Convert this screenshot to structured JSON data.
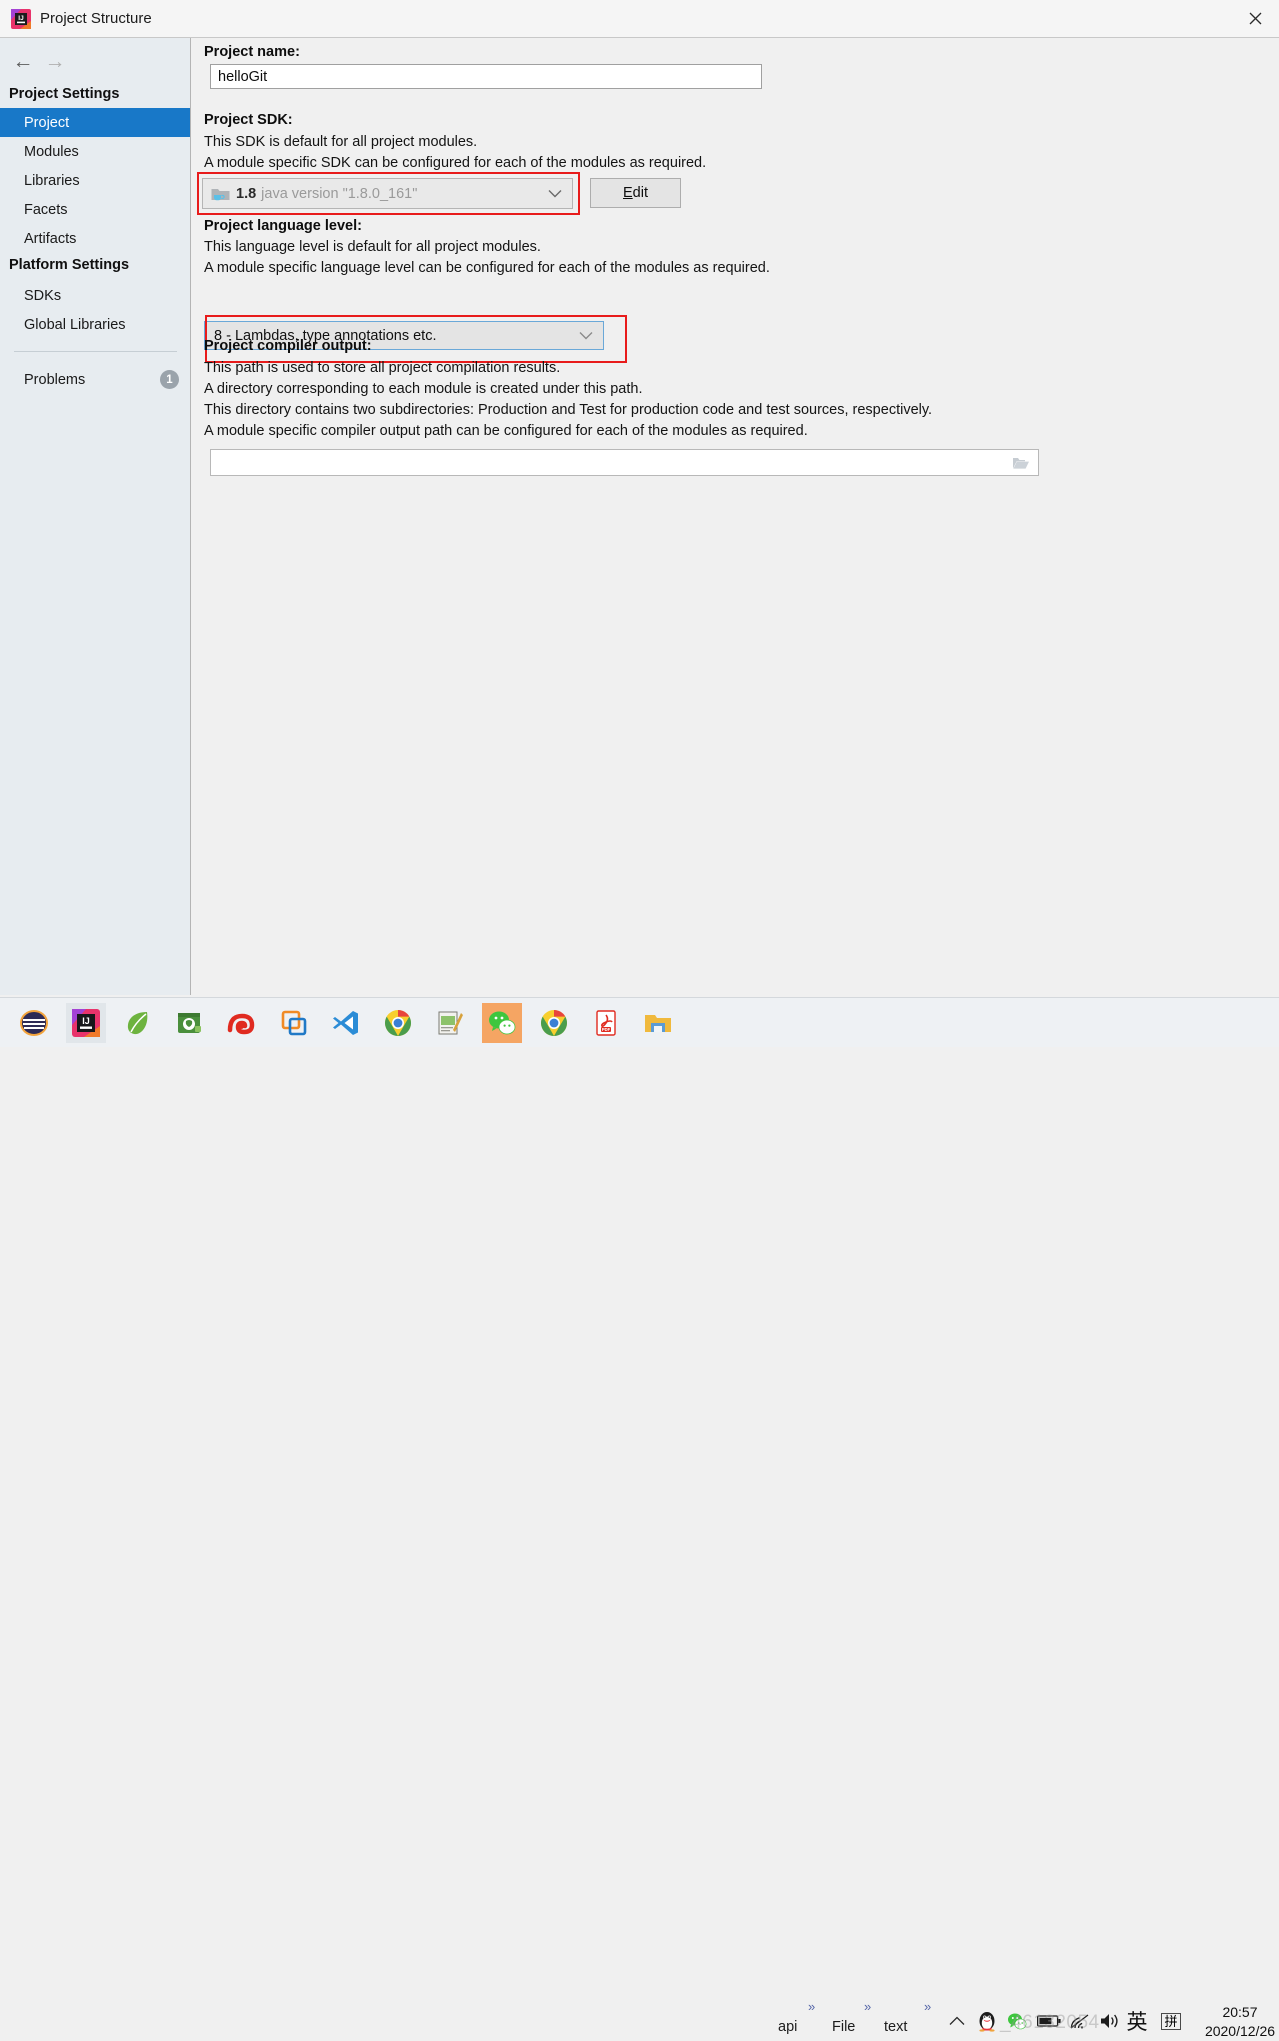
{
  "window": {
    "title": "Project Structure",
    "app_icon": "intellij-idea-icon",
    "close_icon": "close-icon"
  },
  "sidebar": {
    "nav": {
      "back_icon": "arrow-left-icon",
      "forward_icon": "arrow-right-icon"
    },
    "groups": [
      {
        "label": "Project Settings"
      },
      {
        "label": "Platform Settings"
      }
    ],
    "project_items": [
      {
        "label": "Project",
        "selected": true
      },
      {
        "label": "Modules",
        "selected": false
      },
      {
        "label": "Libraries",
        "selected": false
      },
      {
        "label": "Facets",
        "selected": false
      },
      {
        "label": "Artifacts",
        "selected": false
      }
    ],
    "platform_items": [
      {
        "label": "SDKs",
        "selected": false
      },
      {
        "label": "Global Libraries",
        "selected": false
      }
    ],
    "problems": {
      "label": "Problems",
      "count": "1"
    },
    "selected_color": "#1878c8",
    "background_color": "#e7ecf0"
  },
  "main": {
    "project_name": {
      "label": "Project name:",
      "value": "helloGit"
    },
    "project_sdk": {
      "label": "Project SDK:",
      "desc_line1": "This SDK is default for all project modules.",
      "desc_line2": "A module specific SDK can be configured for each of the modules as required.",
      "sdk_icon": "java-sdk-folder-icon",
      "version": "1.8",
      "version_desc": "java version \"1.8.0_161\"",
      "chevron": "⌄",
      "edit_button": "Edit",
      "edit_mnemonic": "E",
      "edit_rest": "dit"
    },
    "language_level": {
      "label": "Project language level:",
      "desc_line1": "This language level is default for all project modules.",
      "desc_line2": "A module specific language level can be configured for each of the modules as required.",
      "value": "8 - Lambdas, type annotations etc.",
      "chevron": "⌄"
    },
    "compiler_output": {
      "label": "Project compiler output:",
      "desc_line1": "This path is used to store all project compilation results.",
      "desc_line2": "A directory corresponding to each module is created under this path.",
      "desc_line3": "This directory contains two subdirectories: Production and Test for production code and test sources, respectively.",
      "desc_line4": "A module specific compiler output path can be configured for each of the modules as required.",
      "value": "",
      "placeholder": "",
      "browse_icon": "folder-browse-icon"
    },
    "annotation_color": "#e81b1b"
  },
  "taskbar": {
    "apps": [
      {
        "name": "eclipse-icon",
        "state": "normal"
      },
      {
        "name": "intellij-idea-icon",
        "state": "active"
      },
      {
        "name": "spring-leaf-icon",
        "state": "normal"
      },
      {
        "name": "github-desktop-icon",
        "state": "normal"
      },
      {
        "name": "snail-browser-icon",
        "state": "normal"
      },
      {
        "name": "vmware-icon",
        "state": "normal"
      },
      {
        "name": "vscode-icon",
        "state": "normal"
      },
      {
        "name": "chrome-icon",
        "state": "normal"
      },
      {
        "name": "notepad-editor-icon",
        "state": "normal"
      },
      {
        "name": "wechat-icon",
        "state": "accent"
      },
      {
        "name": "chrome-icon-2",
        "state": "normal"
      },
      {
        "name": "pdf-icon",
        "state": "normal"
      },
      {
        "name": "file-explorer-icon",
        "state": "normal"
      }
    ],
    "toolbar_items": [
      {
        "label": "api",
        "chevron": "»"
      },
      {
        "label": "File",
        "chevron": "»"
      },
      {
        "label": "text",
        "chevron": "»"
      }
    ],
    "tray": [
      {
        "name": "show-hidden-icons-caret"
      },
      {
        "name": "qq-penguin-icon"
      },
      {
        "name": "wechat-tray-icon"
      },
      {
        "name": "battery-icon"
      },
      {
        "name": "wifi-icon"
      },
      {
        "name": "volume-icon"
      },
      {
        "name": "ime-language-icon",
        "label": "英"
      },
      {
        "name": "ime-pinyin-icon",
        "label": "拼"
      }
    ],
    "clock": {
      "time": "20:57",
      "date": "2020/12/26"
    },
    "watermark": "_46132054"
  }
}
